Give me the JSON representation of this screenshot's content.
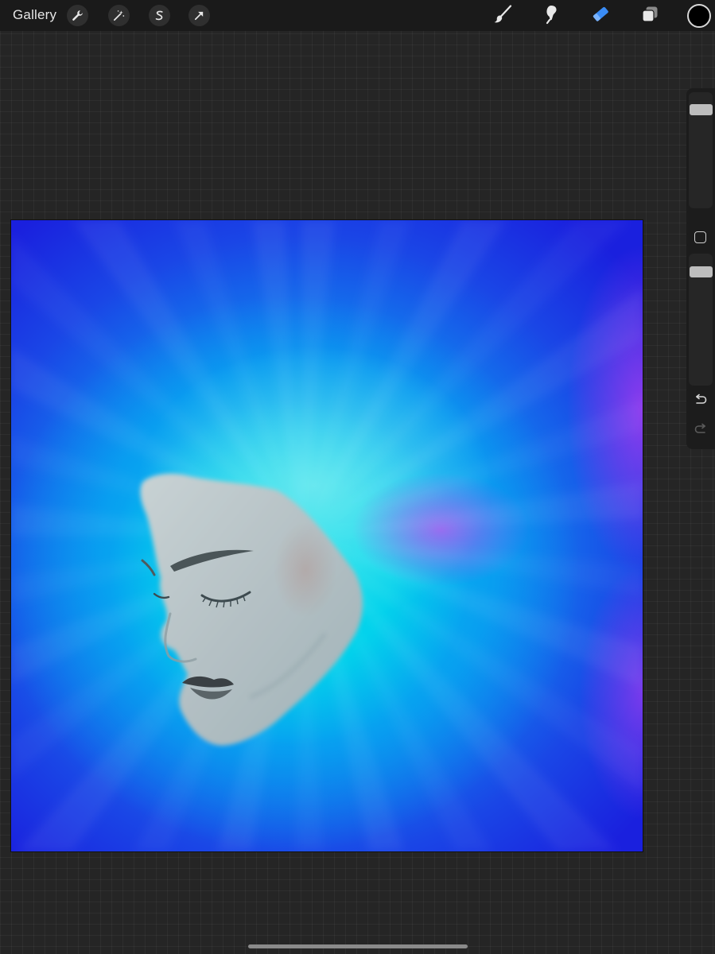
{
  "toolbar": {
    "gallery_label": "Gallery",
    "left_tools": [
      {
        "name": "actions",
        "icon": "wrench-icon"
      },
      {
        "name": "adjustments",
        "icon": "magic-wand-icon"
      },
      {
        "name": "selection",
        "icon": "selection-s-icon"
      },
      {
        "name": "transform",
        "icon": "arrow-cursor-icon"
      }
    ],
    "right_tools": [
      {
        "name": "brush",
        "icon": "brush-icon",
        "active": false
      },
      {
        "name": "smudge",
        "icon": "smudge-icon",
        "active": false
      },
      {
        "name": "eraser",
        "icon": "eraser-icon",
        "active": true
      },
      {
        "name": "layers",
        "icon": "layers-icon",
        "active": false
      }
    ],
    "current_color": "#000000",
    "active_tool_color": "#3a8cf5"
  },
  "canvas": {
    "description_colors": {
      "dark_blue": "#1a20de",
      "cyan": "#00e1eb",
      "magenta_accent": "#be50f0"
    }
  },
  "sidebar": {
    "brush_size_level": 0.05,
    "opacity_level": 0.05,
    "modify_icon": "square-icon",
    "undo_icon": "undo-icon",
    "redo_icon": "redo-icon",
    "redo_enabled": false
  }
}
